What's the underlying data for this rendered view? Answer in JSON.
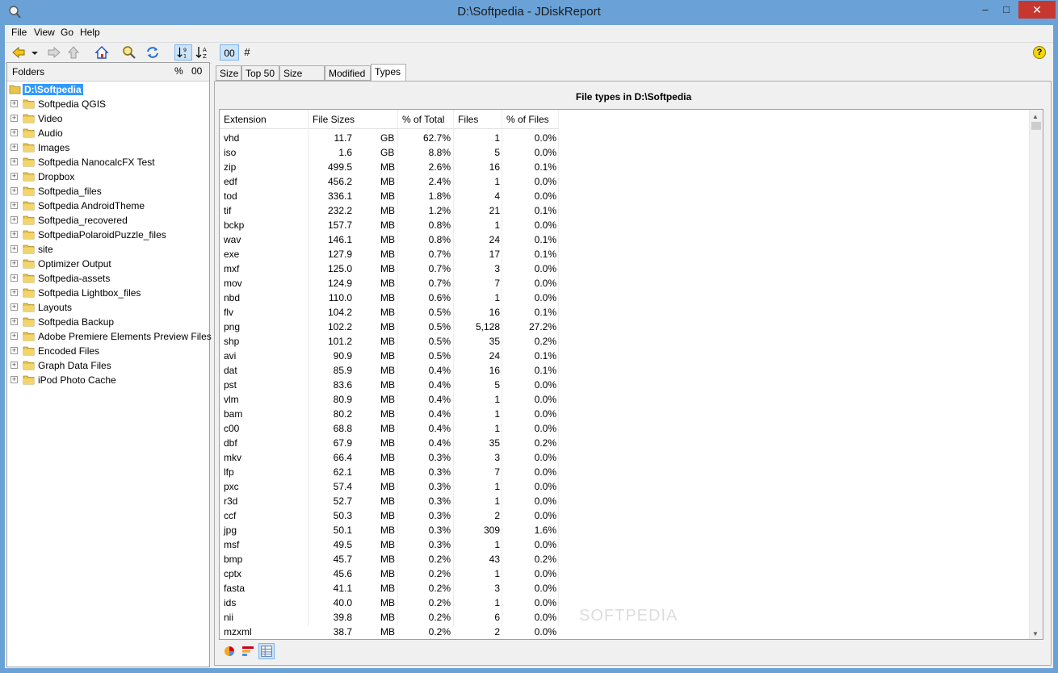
{
  "window": {
    "title": "D:\\Softpedia - JDiskReport",
    "minimize": "–",
    "maximize": "□",
    "close": "✕"
  },
  "menu": [
    "File",
    "View",
    "Go",
    "Help"
  ],
  "toolbar": {
    "count_glyph": "#",
    "help_glyph": "?"
  },
  "folders_panel": {
    "header": "Folders",
    "pct": "%",
    "oo": "00",
    "root": "D:\\Softpedia",
    "items": [
      "Softpedia QGIS",
      "Video",
      "Audio",
      "Images",
      "Softpedia NanocalcFX Test",
      "Dropbox",
      "Softpedia_files",
      "Softpedia AndroidTheme",
      "Softpedia_recovered",
      "SoftpediaPolaroidPuzzle_files",
      "site",
      "Optimizer Output",
      "Softpedia-assets",
      "Softpedia Lightbox_files",
      "Layouts",
      "Softpedia Backup",
      "Adobe Premiere Elements Preview Files",
      "Encoded Files",
      "Graph Data Files",
      "iPod Photo Cache"
    ]
  },
  "tabs": [
    "Size",
    "Top 50",
    "Size Dist",
    "Modified",
    "Types"
  ],
  "report": {
    "title": "File types in D:\\Softpedia",
    "columns": [
      "Extension",
      "File Sizes",
      "% of Total",
      "Files",
      "% of Files"
    ],
    "rows": [
      [
        "vhd",
        "11.7",
        "GB",
        "62.7%",
        "1",
        "0.0%"
      ],
      [
        "iso",
        "1.6",
        "GB",
        "8.8%",
        "5",
        "0.0%"
      ],
      [
        "zip",
        "499.5",
        "MB",
        "2.6%",
        "16",
        "0.1%"
      ],
      [
        "edf",
        "456.2",
        "MB",
        "2.4%",
        "1",
        "0.0%"
      ],
      [
        "tod",
        "336.1",
        "MB",
        "1.8%",
        "4",
        "0.0%"
      ],
      [
        "tif",
        "232.2",
        "MB",
        "1.2%",
        "21",
        "0.1%"
      ],
      [
        "bckp",
        "157.7",
        "MB",
        "0.8%",
        "1",
        "0.0%"
      ],
      [
        "wav",
        "146.1",
        "MB",
        "0.8%",
        "24",
        "0.1%"
      ],
      [
        "exe",
        "127.9",
        "MB",
        "0.7%",
        "17",
        "0.1%"
      ],
      [
        "mxf",
        "125.0",
        "MB",
        "0.7%",
        "3",
        "0.0%"
      ],
      [
        "mov",
        "124.9",
        "MB",
        "0.7%",
        "7",
        "0.0%"
      ],
      [
        "nbd",
        "110.0",
        "MB",
        "0.6%",
        "1",
        "0.0%"
      ],
      [
        "flv",
        "104.2",
        "MB",
        "0.5%",
        "16",
        "0.1%"
      ],
      [
        "png",
        "102.2",
        "MB",
        "0.5%",
        "5,128",
        "27.2%"
      ],
      [
        "shp",
        "101.2",
        "MB",
        "0.5%",
        "35",
        "0.2%"
      ],
      [
        "avi",
        "90.9",
        "MB",
        "0.5%",
        "24",
        "0.1%"
      ],
      [
        "dat",
        "85.9",
        "MB",
        "0.4%",
        "16",
        "0.1%"
      ],
      [
        "pst",
        "83.6",
        "MB",
        "0.4%",
        "5",
        "0.0%"
      ],
      [
        "vlm",
        "80.9",
        "MB",
        "0.4%",
        "1",
        "0.0%"
      ],
      [
        "bam",
        "80.2",
        "MB",
        "0.4%",
        "1",
        "0.0%"
      ],
      [
        "c00",
        "68.8",
        "MB",
        "0.4%",
        "1",
        "0.0%"
      ],
      [
        "dbf",
        "67.9",
        "MB",
        "0.4%",
        "35",
        "0.2%"
      ],
      [
        "mkv",
        "66.4",
        "MB",
        "0.3%",
        "3",
        "0.0%"
      ],
      [
        "lfp",
        "62.1",
        "MB",
        "0.3%",
        "7",
        "0.0%"
      ],
      [
        "pxc",
        "57.4",
        "MB",
        "0.3%",
        "1",
        "0.0%"
      ],
      [
        "r3d",
        "52.7",
        "MB",
        "0.3%",
        "1",
        "0.0%"
      ],
      [
        "ccf",
        "50.3",
        "MB",
        "0.3%",
        "2",
        "0.0%"
      ],
      [
        "jpg",
        "50.1",
        "MB",
        "0.3%",
        "309",
        "1.6%"
      ],
      [
        "msf",
        "49.5",
        "MB",
        "0.3%",
        "1",
        "0.0%"
      ],
      [
        "bmp",
        "45.7",
        "MB",
        "0.2%",
        "43",
        "0.2%"
      ],
      [
        "cptx",
        "45.6",
        "MB",
        "0.2%",
        "1",
        "0.0%"
      ],
      [
        "fasta",
        "41.1",
        "MB",
        "0.2%",
        "3",
        "0.0%"
      ],
      [
        "ids",
        "40.0",
        "MB",
        "0.2%",
        "1",
        "0.0%"
      ],
      [
        "nii",
        "39.8",
        "MB",
        "0.2%",
        "6",
        "0.0%"
      ],
      [
        "mzxml",
        "38.7",
        "MB",
        "0.2%",
        "2",
        "0.0%"
      ]
    ]
  },
  "watermark": "SOFTPEDIA",
  "colors": {
    "selection": "#3399ff",
    "titlebar": "#6aa2d8",
    "close": "#c7372f",
    "folder": "#e8c44d"
  }
}
